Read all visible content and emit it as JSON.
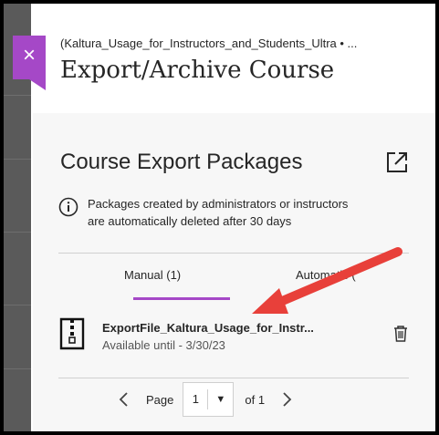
{
  "header": {
    "breadcrumb": "(Kaltura_Usage_for_Instructors_and_Students_Ultra • ...",
    "title": "Export/Archive Course",
    "close_label": "×"
  },
  "section": {
    "title": "Course Export Packages",
    "info_line1": "Packages created by administrators or instructors",
    "info_line2": "are automatically deleted after 30 days"
  },
  "tabs": [
    {
      "label": "Manual (1)",
      "selected": true
    },
    {
      "label": "Automatic (",
      "selected": false
    }
  ],
  "file": {
    "name": "ExportFile_Kaltura_Usage_for_Instr...",
    "availability": "Available until - 3/30/23"
  },
  "pagination": {
    "page_label": "Page",
    "current": "1",
    "of_label": "of 1"
  },
  "colors": {
    "accent": "#a548c7",
    "annotation_arrow": "#e8403a"
  }
}
